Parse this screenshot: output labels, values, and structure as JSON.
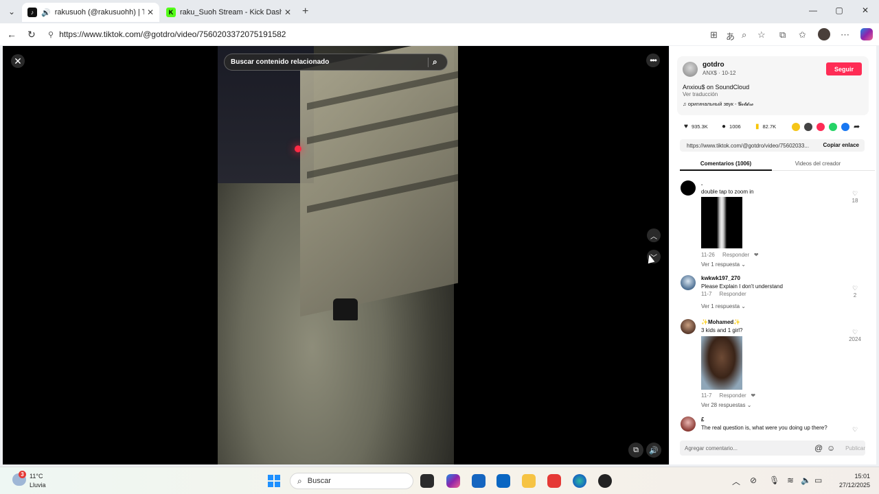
{
  "browser": {
    "tabs": [
      {
        "title": "rakusuoh (@rakusuohh) | TikTok",
        "active": true
      },
      {
        "title": "raku_Suoh Stream - Kick Dashboard",
        "active": false
      }
    ],
    "url": "https://www.tiktok.com/@gotdro/video/7560203372075191582"
  },
  "video": {
    "search_placeholder": "Buscar contenido relacionado"
  },
  "creator": {
    "username": "gotdro",
    "subline": "ANX$ · 10-12",
    "follow_label": "Seguir",
    "description": "Anxiou$ on SoundCloud",
    "translate_label": "Ver traducción",
    "sound": "оригинальный звук - 𝓖𝓸𝓽𝓭𝓻𝓸"
  },
  "stats": {
    "likes": "935.3K",
    "comments": "1006",
    "saves": "82.7K"
  },
  "share": {
    "link": "https://www.tiktok.com/@gotdro/video/75602033...",
    "copy_label": "Copiar enlace"
  },
  "panel_tabs": {
    "comments": "Comentarios (1006)",
    "creator_videos": "Videos del creador"
  },
  "comments": [
    {
      "user": ".",
      "text": "double tap to zoom in",
      "date": "11-26",
      "reply_label": "Responder",
      "replies": "Ver 1 respuesta",
      "likes": "18"
    },
    {
      "user": "kwkwk197_270",
      "text": "Please Explain I don't understand",
      "date": "11-7",
      "reply_label": "Responder",
      "replies": "Ver 1 respuesta",
      "likes": "2"
    },
    {
      "user": "✨Mohamed✨",
      "text": "3 kids and 1 girl?",
      "date": "11-7",
      "reply_label": "Responder",
      "replies": "Ver 28 respuestas",
      "likes": "2024"
    },
    {
      "user": "£",
      "text": "The real question is, what were you doing up there?",
      "date": "",
      "reply_label": "",
      "replies": "",
      "likes": ""
    }
  ],
  "comment_input": {
    "placeholder": "Agregar comentario...",
    "publish_label": "Publicar"
  },
  "taskbar": {
    "weather_badge": "3",
    "temp": "11°C",
    "condition": "Lluvia",
    "search_label": "Buscar",
    "time": "15:01",
    "date": "27/12/2025"
  }
}
